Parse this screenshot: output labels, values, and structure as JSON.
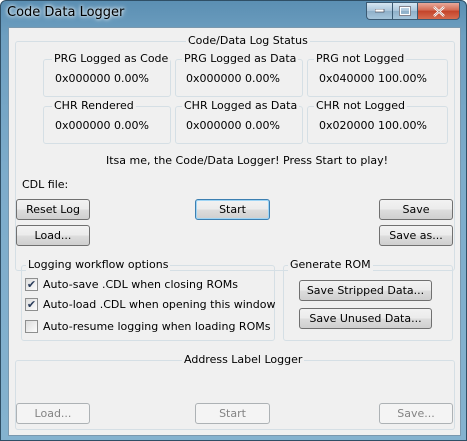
{
  "window": {
    "title": "Code Data Logger"
  },
  "status": {
    "group_label": "Code/Data Log Status",
    "boxes": [
      {
        "label": "PRG Logged as Code",
        "value": "0x000000  0.00%"
      },
      {
        "label": "PRG Logged as Data",
        "value": "0x000000  0.00%"
      },
      {
        "label": "PRG not Logged",
        "value": "0x040000  100.00%"
      },
      {
        "label": "CHR Rendered",
        "value": "0x000000  0.00%"
      },
      {
        "label": "CHR Logged as Data",
        "value": "0x000000  0.00%"
      },
      {
        "label": "CHR not Logged",
        "value": "0x020000  100.00%"
      }
    ],
    "message": "Itsa me, the Code/Data Logger! Press Start to play!",
    "cdl_file_label": "CDL file:"
  },
  "buttons": {
    "reset_log": "Reset Log",
    "start": "Start",
    "save": "Save",
    "load": "Load...",
    "save_as": "Save as..."
  },
  "workflow": {
    "group_label": "Logging workflow options",
    "options": [
      {
        "label": "Auto-save .CDL when closing ROMs",
        "checked": true
      },
      {
        "label": "Auto-load .CDL when opening this window",
        "checked": true
      },
      {
        "label": "Auto-resume logging when loading ROMs",
        "checked": false
      }
    ]
  },
  "generate_rom": {
    "group_label": "Generate ROM",
    "save_stripped": "Save Stripped Data...",
    "save_unused": "Save Unused Data..."
  },
  "address_logger": {
    "group_label": "Address Label Logger",
    "load": "Load...",
    "start": "Start",
    "save": "Save..."
  }
}
